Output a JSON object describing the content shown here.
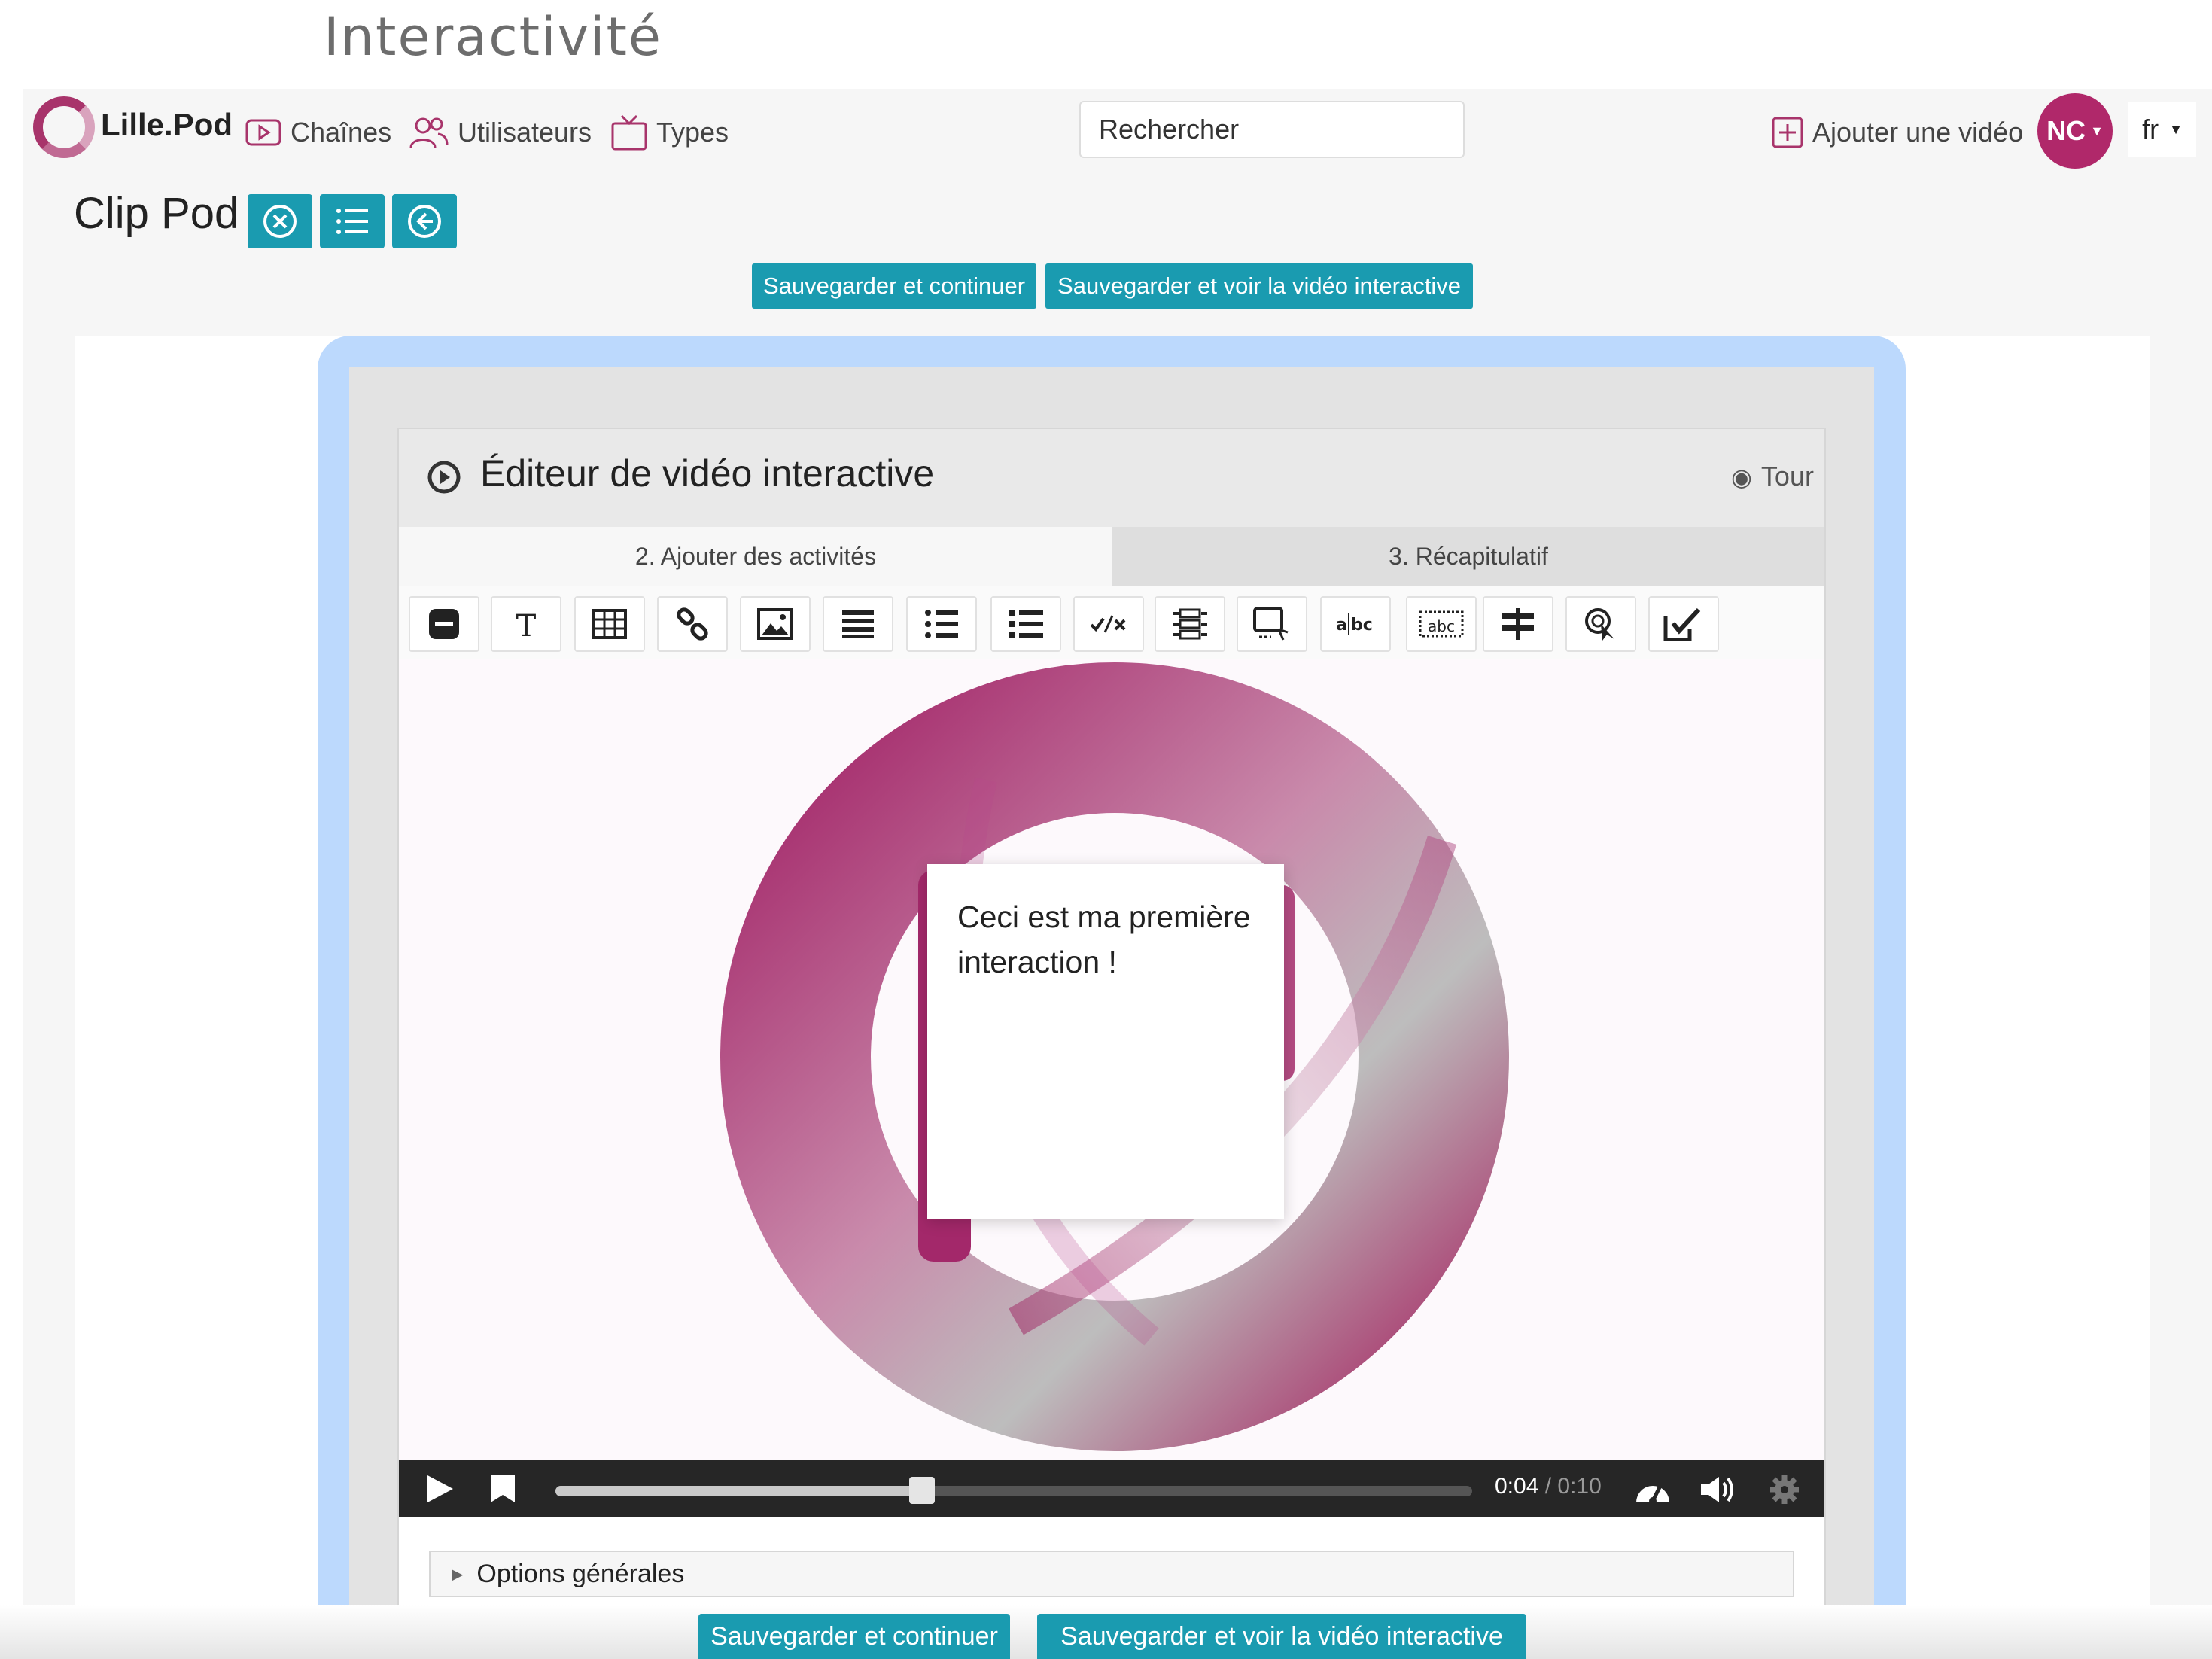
{
  "heading": "Interactivité",
  "navbar": {
    "brand": "Lille.Pod",
    "links": [
      {
        "label": "Chaînes",
        "icon": "play-square-icon"
      },
      {
        "label": "Utilisateurs",
        "icon": "users-icon"
      },
      {
        "label": "Types",
        "icon": "tv-icon"
      }
    ],
    "search_placeholder": "Rechercher",
    "add_video": "Ajouter une vidéo",
    "avatar": "NC",
    "lang": "fr"
  },
  "title": "Clip Pod",
  "title_buttons": [
    "close-circle-icon",
    "list-icon",
    "back-circle-icon"
  ],
  "actions": {
    "save_continue": "Sauvegarder et continuer",
    "save_view": "Sauvegarder et voir la vidéo interactive"
  },
  "editor": {
    "title": "Éditeur de vidéo interactive",
    "tour": "Tour",
    "tabs": [
      {
        "label": "2. Ajouter des activités",
        "active": true
      },
      {
        "label": "3. Récapitulatif",
        "active": false
      }
    ],
    "tools": [
      "label-icon",
      "text-icon",
      "table-icon",
      "link-icon",
      "image-icon",
      "statements-icon",
      "single-choice-icon",
      "multiple-choice-icon",
      "true-false-icon",
      "drag-text-icon",
      "drag-drop-icon",
      "fill-blanks-icon",
      "mark-words-icon",
      "crossroads-icon",
      "navigation-hotspot-icon",
      "summary-icon"
    ],
    "popup_text": "Ceci est ma première interaction !",
    "player": {
      "current_time": "0:04",
      "duration": "0:10",
      "progress": 0.4
    },
    "options_label": "Options générales"
  },
  "colors": {
    "accent": "#1a9bb0",
    "brand": "#a8346b",
    "frame": "#bcd9fd"
  }
}
